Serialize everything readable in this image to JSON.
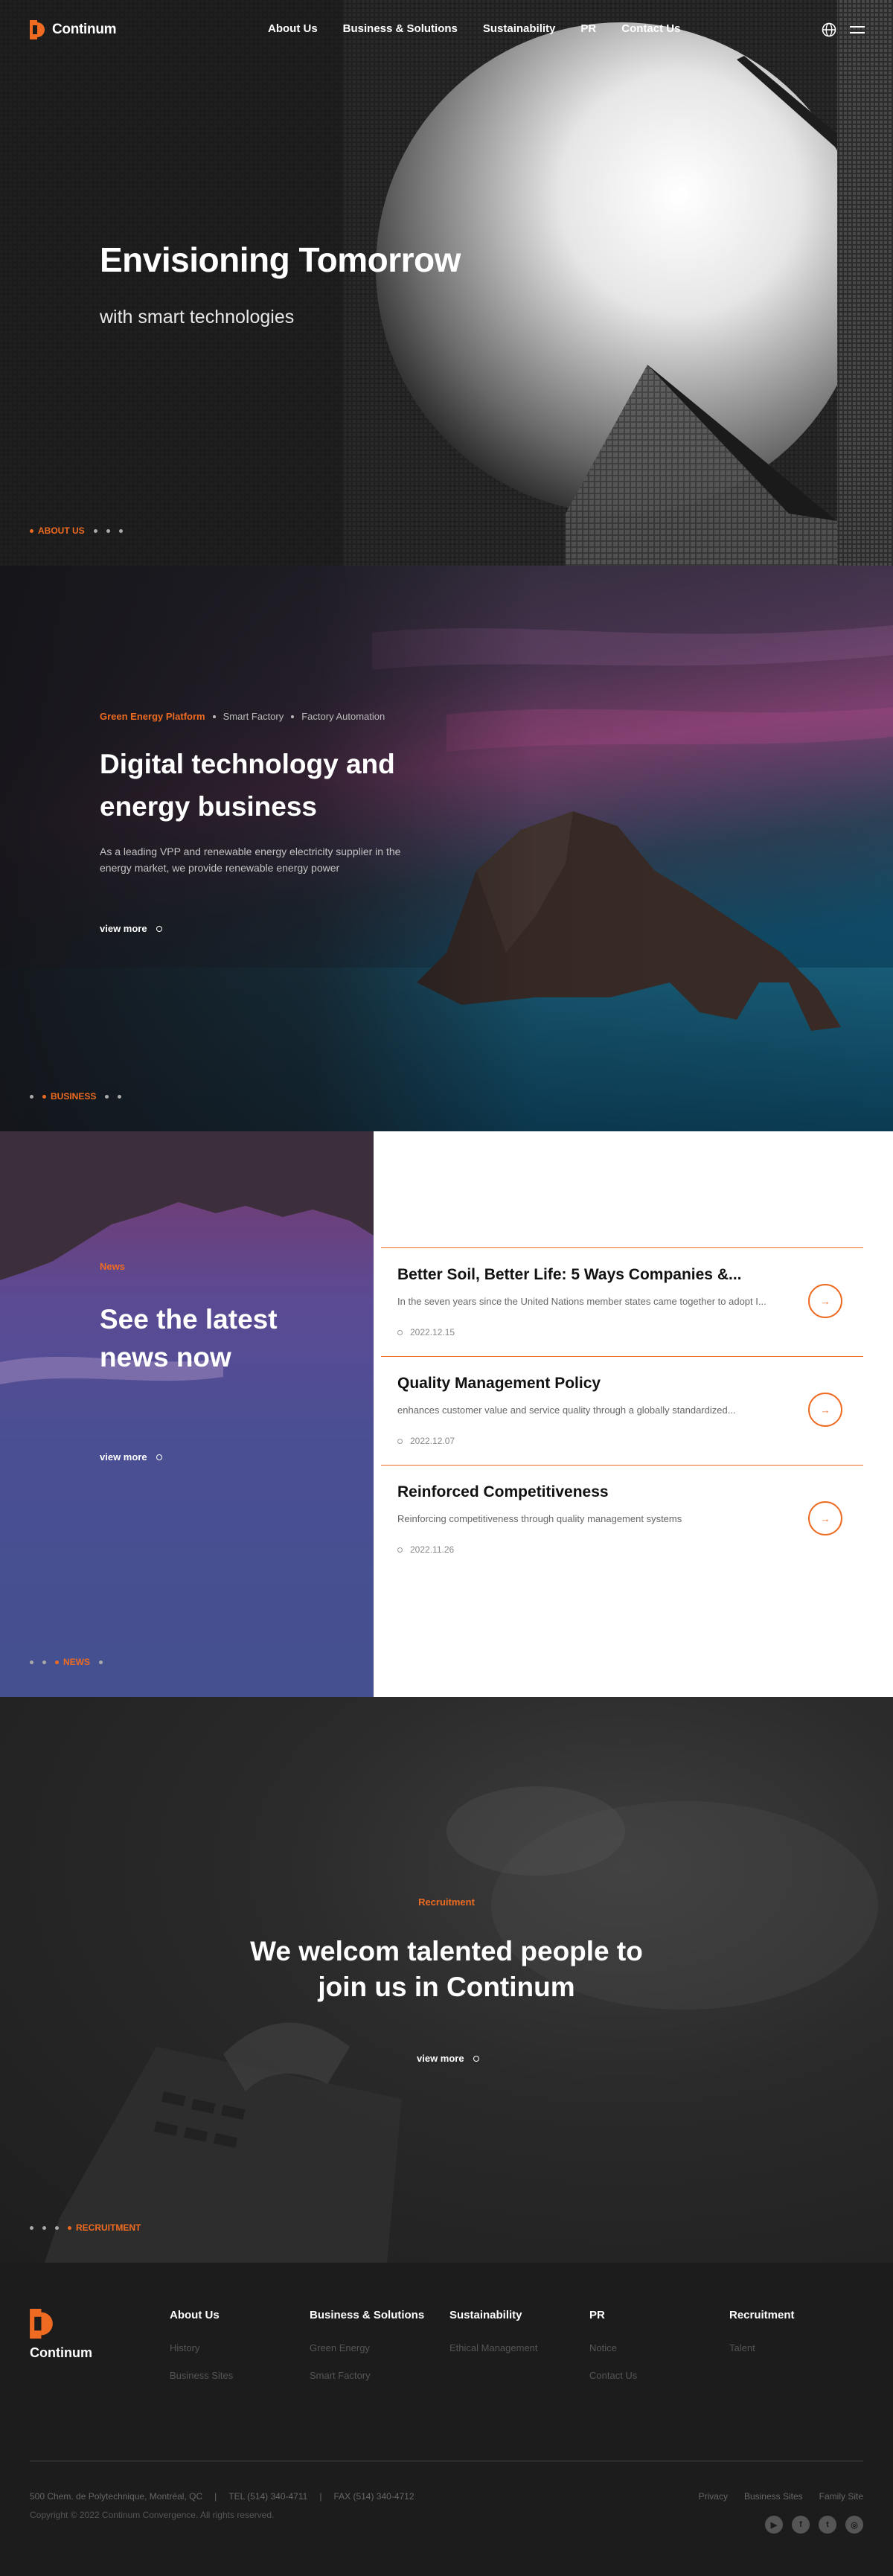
{
  "header": {
    "logo_text": "Continum",
    "nav": [
      "About Us",
      "Business & Solutions",
      "Sustainability",
      "PR",
      "Contact Us"
    ]
  },
  "hero": {
    "title": "Envisioning Tomorrow",
    "subtitle": "with smart technologies",
    "pager_label": "ABOUT US"
  },
  "business": {
    "tabs": [
      "Green Energy Platform",
      "Smart Factory",
      "Factory Automation"
    ],
    "title": "Digital technology and energy business",
    "description": "As a leading VPP and renewable energy electricity supplier in the energy market, we provide renewable energy power",
    "view_more": "view more",
    "pager_label": "BUSINESS"
  },
  "news": {
    "tag": "News",
    "title": "See the latest news now",
    "view_more": "view more",
    "pager_label": "NEWS",
    "items": [
      {
        "title": "Better Soil, Better Life: 5 Ways Companies &...",
        "desc": "In the seven years since the United Nations member states came together to adopt I...",
        "date": "2022.12.15"
      },
      {
        "title": "Quality Management Policy",
        "desc": "enhances customer value and service quality through a globally standardized...",
        "date": "2022.12.07"
      },
      {
        "title": "Reinforced Competitiveness",
        "desc": "Reinforcing competitiveness through quality management systems",
        "date": "2022.11.26"
      }
    ]
  },
  "recruitment": {
    "tag": "Recruitment",
    "title_line1": "We welcom talented people to",
    "title_line2": "join us in Continum",
    "view_more": "view more",
    "pager_label": "RECRUITMENT"
  },
  "footer": {
    "logo_text": "Continum",
    "columns": [
      {
        "heading": "About Us",
        "links": [
          "History",
          "Business Sites"
        ]
      },
      {
        "heading": "Business & Solutions",
        "links": [
          "Green Energy",
          "Smart Factory"
        ]
      },
      {
        "heading": "Sustainability",
        "links": [
          "Ethical Management"
        ]
      },
      {
        "heading": "PR",
        "links": [
          "Notice",
          "Contact Us"
        ]
      },
      {
        "heading": "Recruitment",
        "links": [
          "Talent"
        ]
      }
    ],
    "address": "500 Chem. de Polytechnique, Montréal, QC",
    "tel": "TEL (514) 340-4711",
    "fax": "FAX (514) 340-4712",
    "copyright": "Copyright © 2022 Continum Convergence. All rights reserved.",
    "bottom_links": [
      "Privacy",
      "Business Sites",
      "Family Site"
    ],
    "social_icons": [
      "youtube-icon",
      "facebook-icon",
      "twitter-icon",
      "instagram-icon"
    ]
  },
  "colors": {
    "accent": "#ee6b21",
    "dark": "#1c1c1c"
  }
}
